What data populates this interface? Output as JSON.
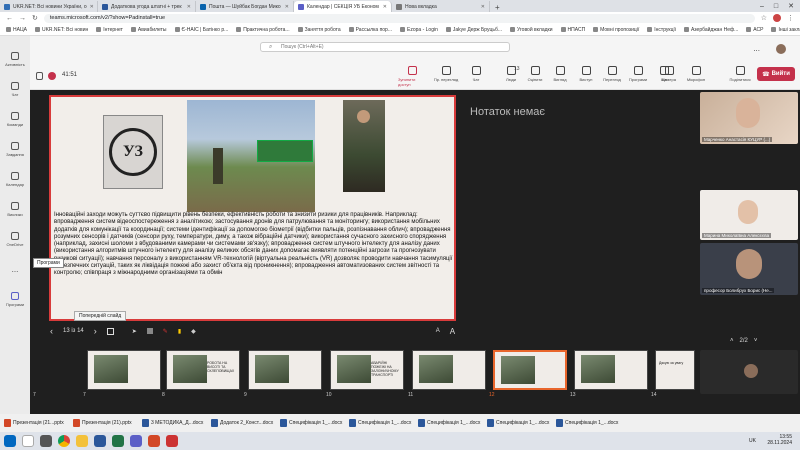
{
  "browser": {
    "tabs": [
      {
        "label": "UKR.NET: Всі новини України, о",
        "color": "#2f6db5"
      },
      {
        "label": "Додаткова угода штатні + трек",
        "color": "#2b579a"
      },
      {
        "label": "Пошта — Шуйбак Богдан Мико",
        "color": "#0a64ad"
      },
      {
        "label": "Календар | СЕКЦІЯ УБ Економ",
        "color": "#5b5fc7"
      },
      {
        "label": "Нова вкладка",
        "color": "#777"
      }
    ],
    "new_tab": "+",
    "url": "teams.microsoft.com/v2/?show=Padinstall=true",
    "bookmarks": [
      "НАЦА",
      "UKR.NET: Всі новин",
      "Інтернет",
      "Авиабилеты",
      "Є-НАІС | Батінко р...",
      "Практична робота...",
      "Заняття робота",
      "Рассылка пор...",
      "Ezopa - Login",
      "Jakye Держ Бруцьб...",
      "Уговой вкладки",
      "НПАСП",
      "Мовні пропозиції",
      "Інструкції",
      "Азербайджан Неф...",
      "АСР",
      "Інші закладки"
    ]
  },
  "teams": {
    "search_placeholder": "Пошук (Ctrl+Alt+E)",
    "more": "...",
    "rail": [
      "Активність",
      "Чат",
      "Команди",
      "Завдання",
      "Календар",
      "Виклики",
      "OneDrive",
      "...",
      "Програми"
    ],
    "timer": "41:51",
    "tools": [
      "Зупинити доступ",
      "Пр. перегляд",
      "Чат",
      "Люди",
      "Оцінити",
      "Вигляд",
      "Виступ",
      "Перегляд",
      "Програми",
      "Ще",
      "Камера",
      "Мікрофон",
      "Поділитися"
    ],
    "people_count": "13",
    "leave_label": "Вийти"
  },
  "slide": {
    "logo_text": "УЗ",
    "body": "Інноваційні заходи можуть суттєво підвищити рівень безпеки, ефективність роботи та знизити ризики для працівників. Наприклад: впровадження систем відеоспостереження з аналітикою; застосування дронів для патрулювання та моніторингу; використання мобільних додатків для комунікації та координації; системи ідентифікації за допомогою біометрії (відбитки пальців, розпізнавання облич); впровадження розумних сенсорів і датчиків (сенсори руху, температури, диму, а також вібраційні датчики); використання сучасного захисного спорядження (наприклад, захисні шоломи з вбудованими камерами чи системами зв'язку); впровадження систем штучного інтелекту для аналізу даних (використання алгоритмів штучного інтелекту для аналізу великих обсягів даних допомагає виявляти потенційні загрози та прогнозувати ризикові ситуації); навчання персоналу з використанням VR-технологій (віртуальна реальність (VR) дозволяє проводити навчання тасимуляції небезпечних ситуацій, таких як ліквідація пожежі або захист об'єкта від проникнення); впровадження автоматизованих систем звітності та контролю; співпраця з міжнародними організаціями та обмін"
  },
  "notes": "Нотаток немає",
  "slide_controls": {
    "prev": "‹",
    "counter": "13 із 14",
    "next": "›",
    "font_smaller": "A",
    "font_larger": "A"
  },
  "tooltips": {
    "prev_slide": "Попередній слайд",
    "apps": "Програми"
  },
  "thumbnails": [
    {
      "n": "7",
      "caption": ""
    },
    {
      "n": "8",
      "caption": ""
    },
    {
      "n": "9",
      "caption": "РОБОТА НА ВИСОТІ ТА СКЛЕПОВИЩАХ"
    },
    {
      "n": "10",
      "caption": ""
    },
    {
      "n": "11",
      "caption": "АВАРІЙНІ ПОЖЕЖІ НА ЗАЛІЗНИЧНОМУ ТРАНСПОРТІ"
    },
    {
      "n": "12",
      "caption": ""
    },
    {
      "n": "13",
      "caption": ""
    },
    {
      "n": "14",
      "caption": ""
    },
    {
      "n": "15",
      "caption": "Дякую за увагу"
    }
  ],
  "participants": [
    {
      "name": "Марченко Анастасія КУЦУР (...)"
    },
    {
      "name": "Марина Миколаївна Алексєєва"
    },
    {
      "name": "професор Болибрух Борис (Не..."
    },
    {
      "name": ""
    }
  ],
  "pager": "2/2",
  "downloads": [
    "Презентація (21...pptx",
    "Презентація (21).pptx",
    "3 МЕТОДИКА_Д...docx",
    "Додаток 2_Конст...docx",
    "Специфікація 1_...docx",
    "Специфікація 1_...docx",
    "Специфікація 1_...docx",
    "Специфікація 1_...docx",
    "Специфікація 1_...docx"
  ],
  "clock": {
    "time": "13:55",
    "date": "28.11.2024",
    "lang": "UK"
  }
}
